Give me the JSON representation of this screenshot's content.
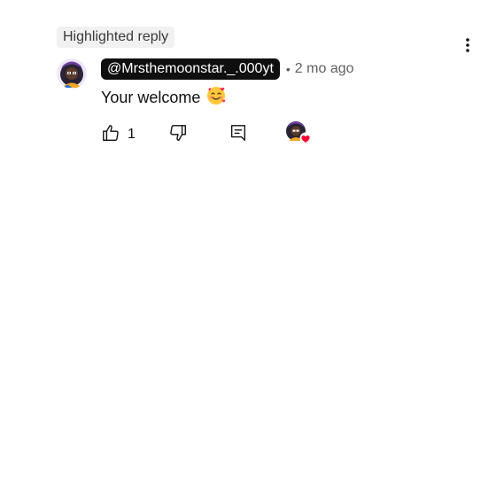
{
  "badge": {
    "label": "Highlighted reply"
  },
  "comment": {
    "author": "@Mrsthemoonstar._.000yt",
    "separator": "•",
    "time": "2 mo ago",
    "text": "Your welcome",
    "emoji_icon": "smiling-face-with-hearts-icon"
  },
  "actions": {
    "like_count": "1",
    "icons": [
      "thumbs-up-icon",
      "thumbs-down-icon",
      "reply-icon",
      "creator-heart-icon"
    ]
  },
  "colors": {
    "author_bg": "#0f0f0f",
    "badge_bg": "#f1f1f1",
    "secondary_text": "#606060",
    "heart": "#ff0033"
  }
}
